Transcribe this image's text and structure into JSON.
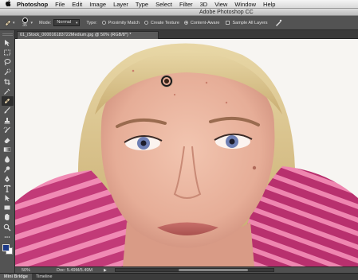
{
  "menubar": {
    "apple_icon": "apple-icon",
    "app_name": "Photoshop",
    "items": [
      "File",
      "Edit",
      "Image",
      "Layer",
      "Type",
      "Select",
      "Filter",
      "3D",
      "View",
      "Window",
      "Help"
    ]
  },
  "window": {
    "title": "Adobe Photoshop CC"
  },
  "options": {
    "tool_icon": "spot-healing-brush-icon",
    "brush_size": "35",
    "mode_label": "Mode:",
    "mode_value": "Normal",
    "type_label": "Type:",
    "proximity_match": "Proximity Match",
    "create_texture": "Create Texture",
    "content_aware": "Content-Aware",
    "selected_type": "Content-Aware",
    "sample_all_layers": "Sample All Layers",
    "sample_all_layers_checked": false
  },
  "tools": [
    {
      "name": "move-tool",
      "icon": "move-icon"
    },
    {
      "name": "marquee-tool",
      "icon": "marquee-icon"
    },
    {
      "name": "lasso-tool",
      "icon": "lasso-icon"
    },
    {
      "name": "quick-selection-tool",
      "icon": "quick-select-icon"
    },
    {
      "name": "crop-tool",
      "icon": "crop-icon"
    },
    {
      "name": "eyedropper-tool",
      "icon": "eyedropper-icon"
    },
    {
      "name": "spot-healing-brush-tool",
      "icon": "bandage-icon",
      "active": true
    },
    {
      "name": "brush-tool",
      "icon": "brush-icon"
    },
    {
      "name": "clone-stamp-tool",
      "icon": "stamp-icon"
    },
    {
      "name": "history-brush-tool",
      "icon": "history-brush-icon"
    },
    {
      "name": "eraser-tool",
      "icon": "eraser-icon"
    },
    {
      "name": "gradient-tool",
      "icon": "gradient-icon"
    },
    {
      "name": "blur-tool",
      "icon": "blur-icon"
    },
    {
      "name": "dodge-tool",
      "icon": "dodge-icon"
    },
    {
      "name": "pen-tool",
      "icon": "pen-icon"
    },
    {
      "name": "type-tool",
      "icon": "type-icon"
    },
    {
      "name": "path-selection-tool",
      "icon": "path-select-icon"
    },
    {
      "name": "rectangle-tool",
      "icon": "rectangle-icon"
    },
    {
      "name": "hand-tool",
      "icon": "hand-icon"
    },
    {
      "name": "zoom-tool",
      "icon": "zoom-icon"
    }
  ],
  "colors": {
    "foreground": "#1c3a88",
    "background": "#ffffff"
  },
  "document": {
    "tab_title": "01_iStock_000016183722Medium.jpg @ 50% (RGB/8*) *"
  },
  "status": {
    "zoom": "50%",
    "doc_info": "Doc: 5.49M/5.49M",
    "arrow": "▶"
  },
  "panels": {
    "tabs": [
      "Mini Bridge",
      "Timeline"
    ],
    "active": "Mini Bridge"
  }
}
